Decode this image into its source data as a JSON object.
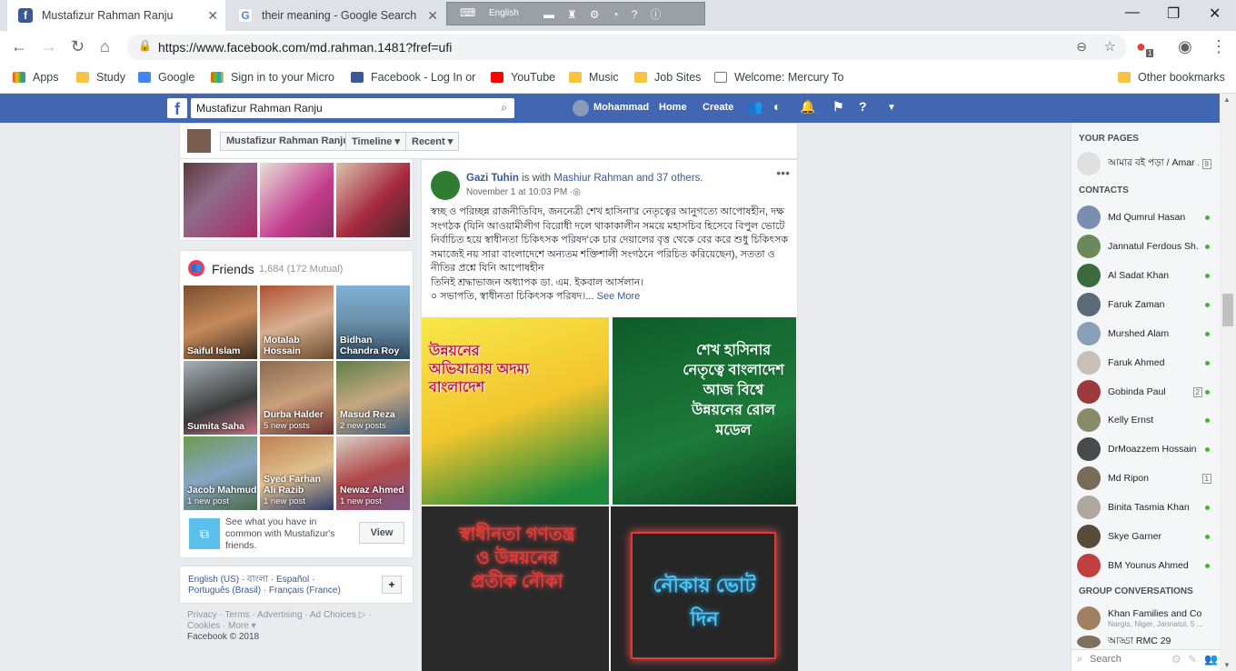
{
  "browser": {
    "tabs": [
      {
        "title": "Mustafizur Rahman Ranju",
        "active": true,
        "icon": "facebook-favicon"
      },
      {
        "title": "their meaning - Google Search",
        "active": false,
        "icon": "google-favicon"
      }
    ],
    "langbar_label": "English",
    "url": "https://www.facebook.com/md.rahman.1481?fref=ufi",
    "extension_badge": "1",
    "bookmarks": [
      "Apps",
      "Study",
      "Google",
      "Sign in to your Micro",
      "Facebook - Log In or",
      "YouTube",
      "Music",
      "Job Sites",
      "Welcome: Mercury To"
    ],
    "other_bookmarks": "Other bookmarks"
  },
  "fb": {
    "search_value": "Mustafizur Rahman Ranju",
    "user": "Mohammad",
    "nav": [
      "Home",
      "Create"
    ],
    "sticky": {
      "name": "Mustafizur Rahman Ranju",
      "timeline": "Timeline",
      "recent": "Recent"
    },
    "friends": {
      "title": "Friends",
      "count": "1,684 (172 Mutual)",
      "list": [
        {
          "name": "Saiful Islam",
          "sub": ""
        },
        {
          "name": "Motalab Hossain",
          "sub": ""
        },
        {
          "name": "Bidhan Chandra Roy",
          "sub": ""
        },
        {
          "name": "Sumita Saha",
          "sub": ""
        },
        {
          "name": "Durba Halder",
          "sub": "5 new posts"
        },
        {
          "name": "Masud Reza",
          "sub": "2 new posts"
        },
        {
          "name": "Jacob Mahmud",
          "sub": "1 new post"
        },
        {
          "name": "Syed Farhan Ali Razib",
          "sub": "1 new post"
        },
        {
          "name": "Newaz Ahmed",
          "sub": "1 new post"
        }
      ],
      "common_text": "See what you have in common with Mustafizur's friends.",
      "view_label": "View"
    },
    "languages": {
      "line1": "English (US) · বাংলা · Español ·",
      "line2": "Português (Brasil) · Français (France)",
      "add": "+"
    },
    "footer": {
      "links": "Privacy · Terms · Advertising · Ad Choices ▷ · Cookies · More ▾",
      "copyright": "Facebook © 2018"
    },
    "post": {
      "author": "Gazi Tuhin",
      "with_text": "is with",
      "tagged": "Mashiur Rahman",
      "others": "and 37 others.",
      "time": "November 1 at 10:03 PM",
      "body": "স্বচ্ছ ও পরিচ্ছন্ন রাজনীতিবিদ, জননেত্রী শেখ হাসিনা'র নেতৃত্বের আনুগত্যে আপোষহীন, দক্ষ সংগঠক (যিনি আওয়ামীলীগ বিরোধী দলে থাকাকালীন সময়ে মহাসচিব হিসেবে বিপুল ভোটে নির্বাচিত হয়ে স্বাধীনতা চিকিৎসক পরিষদ'কে চার দেয়ালের বৃত্ত থেকে বের করে শুধু চিকিৎসক সমাজেই নয় সারা বাংলাদেশে অন্যতম শক্তিশালী সংগঠনে পরিচিত করিয়েছেন), সততা ও নীতির প্রশ্নে যিনি আপোষহীন",
      "line2": "তিনিই শ্রদ্ধাভাজন অধ্যাপক ডা. এম. ইকবাল আর্সলান।",
      "line3": "০ সভাপতি, স্বাধীনতা চিকিৎসক পরিষদ।...",
      "see_more": "See More",
      "img1_text": "উন্নয়নের অভিযাত্রায় অদম্য বাংলাদেশ",
      "img2_text": "শেখ হাসিনার নেতৃত্বে বাংলাদেশ আজ বিশ্বে উন্নয়নের রোল মডেল",
      "img3_text": "স্বাধীনতা গণতন্ত্র ও উন্নয়নের প্রতীক নৌকা",
      "img4_text": "নৌকায় ভোট দিন"
    }
  },
  "chat": {
    "your_pages": "YOUR PAGES",
    "page": {
      "name": "আমার বই পড়া / Amar ...",
      "count": "9"
    },
    "contacts_title": "CONTACTS",
    "contacts": [
      {
        "name": "Md Qumrul Hasan",
        "online": true
      },
      {
        "name": "Jannatul Ferdous Sh...",
        "online": true
      },
      {
        "name": "Al Sadat Khan",
        "online": true
      },
      {
        "name": "Faruk Zaman",
        "online": true
      },
      {
        "name": "Murshed Alam",
        "online": true
      },
      {
        "name": "Faruk Ahmed",
        "online": true
      },
      {
        "name": "Gobinda Paul",
        "online": true,
        "count": "2"
      },
      {
        "name": "Kelly Ernst",
        "online": true
      },
      {
        "name": "DrMoazzem Hossain ...",
        "online": true
      },
      {
        "name": "Md Ripon",
        "online": false,
        "count": "1"
      },
      {
        "name": "Binita Tasmia Khan",
        "online": true
      },
      {
        "name": "Skye Garner",
        "online": true
      },
      {
        "name": "BM Younus Ahmed",
        "online": true
      }
    ],
    "group_title": "GROUP CONVERSATIONS",
    "groups": [
      {
        "name": "Khan Families and Co",
        "sub": "Nargis, Niger, Jannatul, 5 ..."
      },
      {
        "name": "আড্ডা RMC 29",
        "sub": ""
      }
    ],
    "search_placeholder": "Search"
  }
}
